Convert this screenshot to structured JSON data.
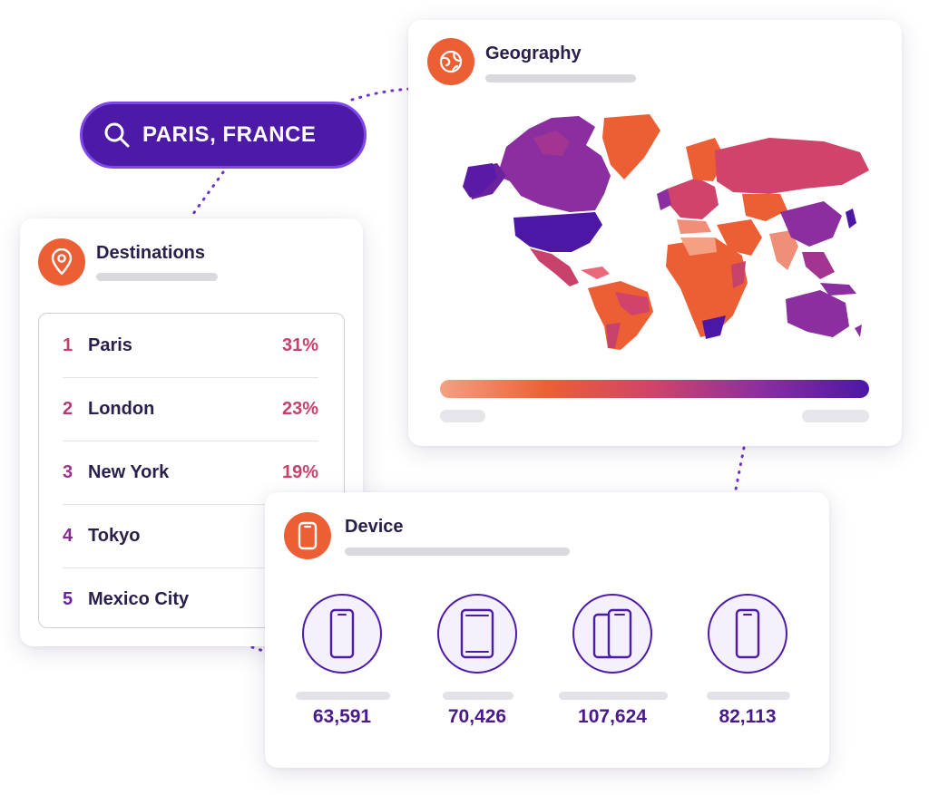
{
  "search": {
    "label": "PARIS, FRANCE"
  },
  "geography": {
    "title": "Geography"
  },
  "destinations": {
    "title": "Destinations",
    "items": [
      {
        "rank": "1",
        "name": "Paris",
        "percent": "31%"
      },
      {
        "rank": "2",
        "name": "London",
        "percent": "23%"
      },
      {
        "rank": "3",
        "name": "New York",
        "percent": "19%"
      },
      {
        "rank": "4",
        "name": "Tokyo",
        "percent": ""
      },
      {
        "rank": "5",
        "name": "Mexico City",
        "percent": ""
      }
    ]
  },
  "device": {
    "title": "Device",
    "items": [
      {
        "icon": "smartphone-icon",
        "value": "63,591"
      },
      {
        "icon": "tablet-icon",
        "value": "70,426"
      },
      {
        "icon": "multi-device-icon",
        "value": "107,624"
      },
      {
        "icon": "smartphone-icon",
        "value": "82,113"
      }
    ]
  },
  "colors": {
    "accent_orange": "#ec5f35",
    "accent_purple": "#4c1aa6",
    "rank_gradient": [
      "#c8416a",
      "#b03a7a",
      "#9a3288",
      "#842a94",
      "#6a22a0"
    ],
    "map_scale": [
      "#f5a083",
      "#ec5f35",
      "#d0436a",
      "#8b2ea0",
      "#4d17a6"
    ]
  }
}
